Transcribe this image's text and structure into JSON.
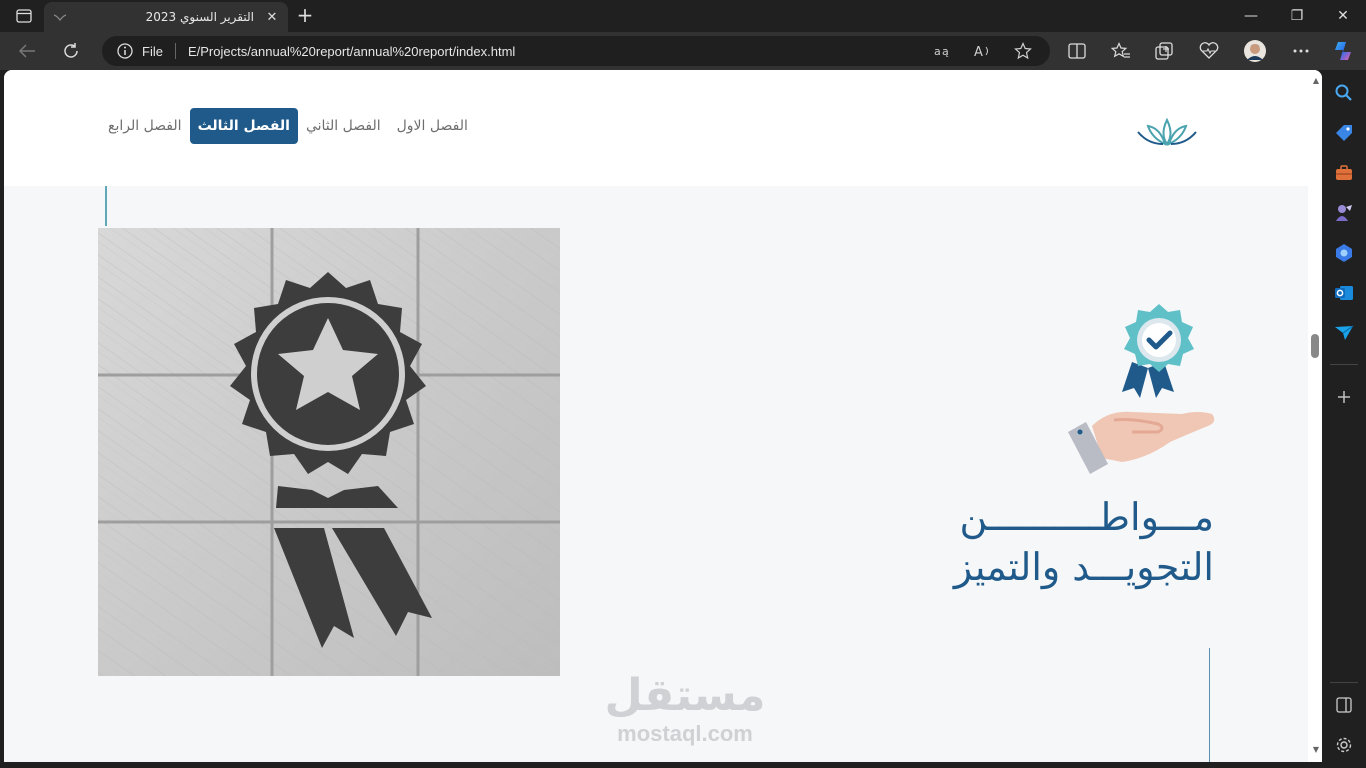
{
  "browser": {
    "tab_title": "التقرير السنوي 2023",
    "tab_close": "✕",
    "new_tab": "+",
    "scheme_label": "File",
    "url": "E/Projects/annual%20report/annual%20report/index.html",
    "window_controls": {
      "minimize": "—",
      "maximize": "❐",
      "close": "✕"
    }
  },
  "page": {
    "nav": [
      {
        "label": "الفصل الاول",
        "active": false
      },
      {
        "label": "الفصل الثاني",
        "active": false
      },
      {
        "label": "الفصل الثالث",
        "active": true
      },
      {
        "label": "الفصل الرابع",
        "active": false
      }
    ],
    "heading_line1": "مـــواطــــــــــن",
    "heading_line2": "التجويـــد والتميز",
    "watermark_ar": "مستقل",
    "watermark_en": "mostaql.com"
  },
  "colors": {
    "accent": "#1f5a8a",
    "teal": "#5fb8c4",
    "hero_bg": "#f6f7f9"
  },
  "icons": [
    "sidebar-tabs-icon",
    "back-icon",
    "refresh-icon",
    "info-icon",
    "read-aloud-icon",
    "favorite-icon",
    "split-screen-icon",
    "favorites-icon",
    "collections-icon",
    "health-icon",
    "profile-avatar",
    "more-icon",
    "copilot-icon"
  ]
}
